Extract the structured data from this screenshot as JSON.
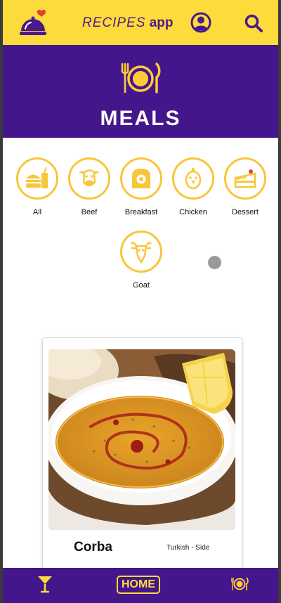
{
  "header": {
    "title_italic": "RECIPES",
    "title_bold": "app",
    "logo_icon": "cloche-with-heart-icon",
    "profile_icon": "profile-icon",
    "search_icon": "search-icon"
  },
  "hero": {
    "icon": "plate-fork-knife-icon",
    "title": "MEALS"
  },
  "categories": [
    {
      "label": "All",
      "icon": "burger-fries-drink-icon"
    },
    {
      "label": "Beef",
      "icon": "cow-icon"
    },
    {
      "label": "Breakfast",
      "icon": "toast-egg-icon"
    },
    {
      "label": "Chicken",
      "icon": "chick-icon"
    },
    {
      "label": "Dessert",
      "icon": "cake-icon"
    },
    {
      "label": "Goat",
      "icon": "goat-icon"
    }
  ],
  "recipe_card": {
    "name": "Corba",
    "tags": "Turkish - Side",
    "image": "lentil-soup-photo"
  },
  "bottom_nav": {
    "cocktail_icon": "cocktail-glass-icon",
    "home_label": "HOME",
    "meals_icon": "plate-icon"
  },
  "colors": {
    "accent_yellow": "#fddb3a",
    "brand_purple": "#44168c",
    "icon_ring": "#f8c63a"
  }
}
